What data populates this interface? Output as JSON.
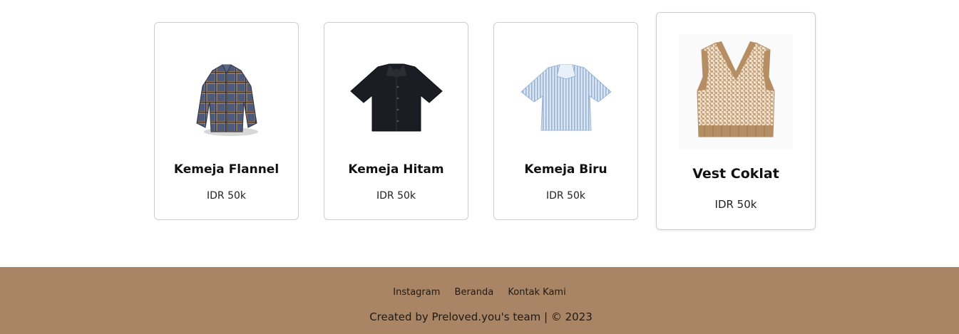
{
  "products": [
    {
      "name": "Kemeja Flannel",
      "price": "IDR 50k",
      "image": "plaid-flannel-shirt"
    },
    {
      "name": "Kemeja Hitam",
      "price": "IDR 50k",
      "image": "black-short-sleeve-shirt"
    },
    {
      "name": "Kemeja Biru",
      "price": "IDR 50k",
      "image": "blue-striped-shirt"
    },
    {
      "name": "Vest Coklat",
      "price": "IDR 50k",
      "image": "brown-knit-vest"
    }
  ],
  "footer": {
    "links": [
      "Instagram",
      "Beranda",
      "Kontak Kami"
    ],
    "credit": "Created by Preloved.you's team | © 2023"
  },
  "colors": {
    "footer_bg": "#a98566",
    "card_border": "#cfcfcf",
    "text": "#111111"
  }
}
